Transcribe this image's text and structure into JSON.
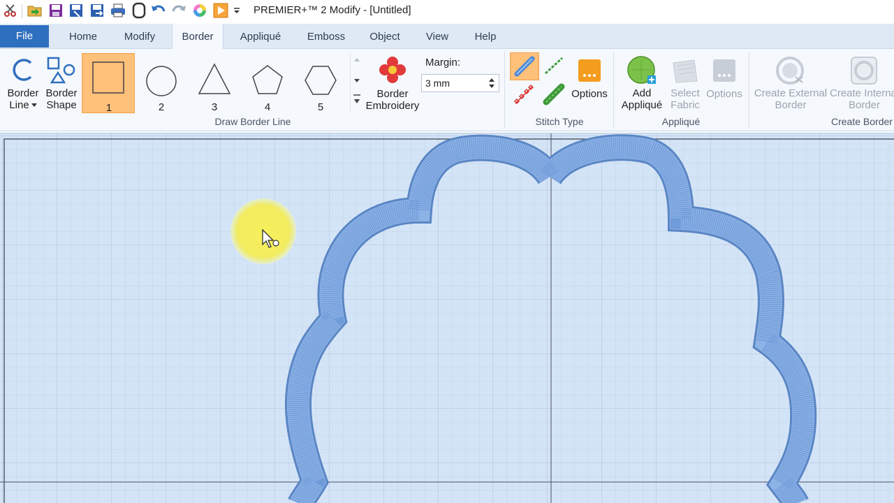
{
  "window": {
    "title": "PREMIER+™ 2 Modify - [Untitled]"
  },
  "tabs": [
    {
      "label": "File"
    },
    {
      "label": "Home"
    },
    {
      "label": "Modify"
    },
    {
      "label": "Border"
    },
    {
      "label": "Appliqué"
    },
    {
      "label": "Emboss"
    },
    {
      "label": "Object"
    },
    {
      "label": "View"
    },
    {
      "label": "Help"
    }
  ],
  "ribbon": {
    "border_line": {
      "line1": "Border",
      "line2": "Line"
    },
    "border_shape": {
      "line1": "Border",
      "line2": "Shape"
    },
    "shapes": [
      "1",
      "2",
      "3",
      "4",
      "5"
    ],
    "draw_border_line_group": "Draw Border Line",
    "border_embroidery": {
      "line1": "Border",
      "line2": "Embroidery"
    },
    "margin": {
      "label": "Margin:",
      "value": "3 mm"
    },
    "stitch_options": "Options",
    "stitch_type_group": "Stitch Type",
    "add_applique": {
      "line1": "Add",
      "line2": "Appliqué"
    },
    "select_fabric": {
      "line1": "Select",
      "line2": "Fabric"
    },
    "applique_options": "Options",
    "applique_group": "Appliqué",
    "create_external_border": {
      "line1": "Create External",
      "line2": "Border"
    },
    "create_internal_border": {
      "line1": "Create Internal",
      "line2": "Border"
    },
    "create_border_group": "Create Border"
  },
  "colors": {
    "accent": "#2f6fbf",
    "selected_shape": "#ffc07a",
    "canvas": "#d4e4f7",
    "embroidery": "#6f9bd8",
    "cursor_highlight": "#f5f05a"
  }
}
